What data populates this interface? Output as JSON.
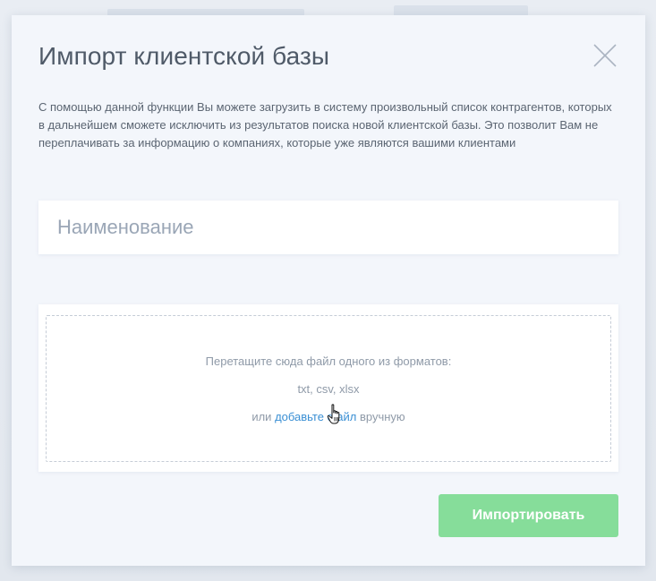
{
  "modal": {
    "title": "Импорт клиентской базы",
    "description": "С помощью данной функции Вы можете загрузить в систему произвольный список контрагентов, которых в дальнейшем сможете исключить из результатов поиска новой клиентской базы. Это позволит Вам не переплачивать за информацию о компаниях, которые уже являются вашими клиентами"
  },
  "name_field": {
    "placeholder": "Наименование",
    "value": ""
  },
  "dropzone": {
    "instruction": "Перетащите сюда файл одного из форматов:",
    "formats": "txt, csv, xlsx",
    "prefix": "или",
    "link_label": "добавьте файл",
    "suffix": "вручную"
  },
  "actions": {
    "import_label": "Импортировать"
  },
  "icons": {
    "close": "close-icon",
    "cursor": "hand-pointer-icon"
  },
  "colors": {
    "primary_button": "#86dd9a",
    "link": "#3a8fd4",
    "title_text": "#4f5a68"
  }
}
